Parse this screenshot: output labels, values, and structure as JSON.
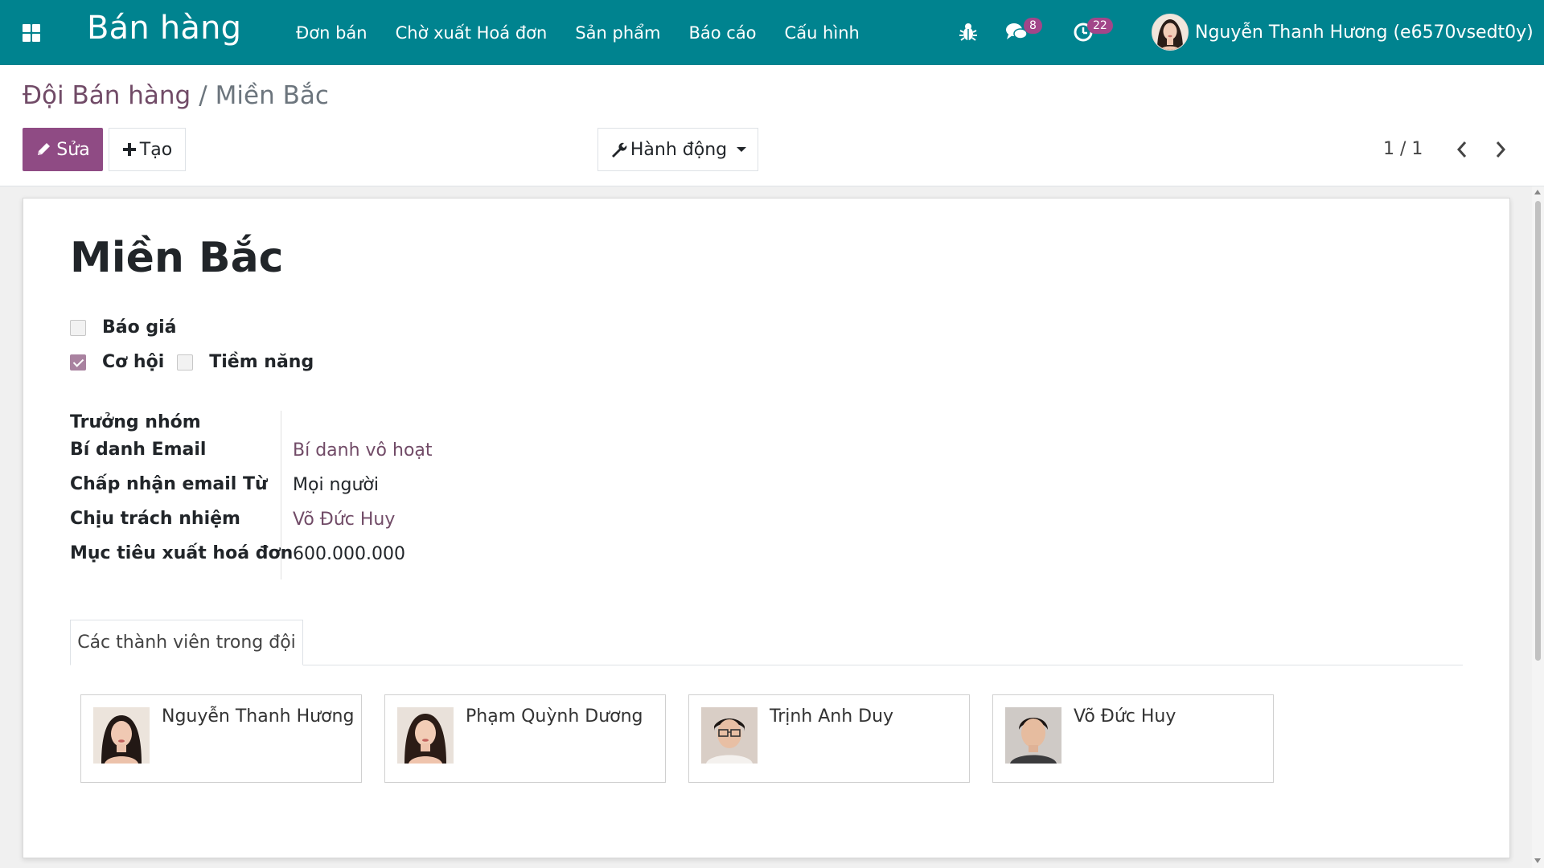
{
  "navbar": {
    "app_title": "Bán hàng",
    "menu": [
      "Đơn bán",
      "Chờ xuất Hoá đơn",
      "Sản phẩm",
      "Báo cáo",
      "Cấu hình"
    ],
    "messages_badge": "8",
    "activities_badge": "22",
    "user_name": "Nguyễn Thanh Hương (e6570vsedt0y)",
    "bg_color": "#00838f",
    "badge_color": "#a24689"
  },
  "breadcrumb": {
    "parent": "Đội Bán hàng",
    "separator": "/",
    "current": "Miền Bắc"
  },
  "toolbar": {
    "edit_label": "Sửa",
    "create_label": "Tạo",
    "action_label": "Hành động",
    "pager": "1 / 1",
    "accent_color": "#8f4b84"
  },
  "record": {
    "title": "Miền Bắc",
    "checkboxes": [
      {
        "label": "Báo giá",
        "checked": false
      },
      {
        "label": "Cơ hội",
        "checked": true
      },
      {
        "label": "Tiềm năng",
        "checked": false
      }
    ],
    "fields": [
      {
        "label": "Trưởng nhóm",
        "value": ""
      },
      {
        "label": "Bí danh Email",
        "value": "Bí danh vô hoạt"
      },
      {
        "label": "Chấp nhận email Từ",
        "value": "Mọi người"
      },
      {
        "label": "Chịu trách nhiệm",
        "value": "Võ Đức Huy"
      },
      {
        "label": "Mục tiêu xuất hoá đơn",
        "value": "600.000.000"
      }
    ],
    "tab_label": "Các thành viên trong đội",
    "members": [
      {
        "name": "Nguyễn Thanh Hương",
        "avatar": "female-avatar"
      },
      {
        "name": "Phạm Quỳnh Dương",
        "avatar": "female-avatar"
      },
      {
        "name": "Trịnh Anh Duy",
        "avatar": "male-glasses-avatar"
      },
      {
        "name": "Võ Đức Huy",
        "avatar": "male-avatar"
      }
    ]
  }
}
